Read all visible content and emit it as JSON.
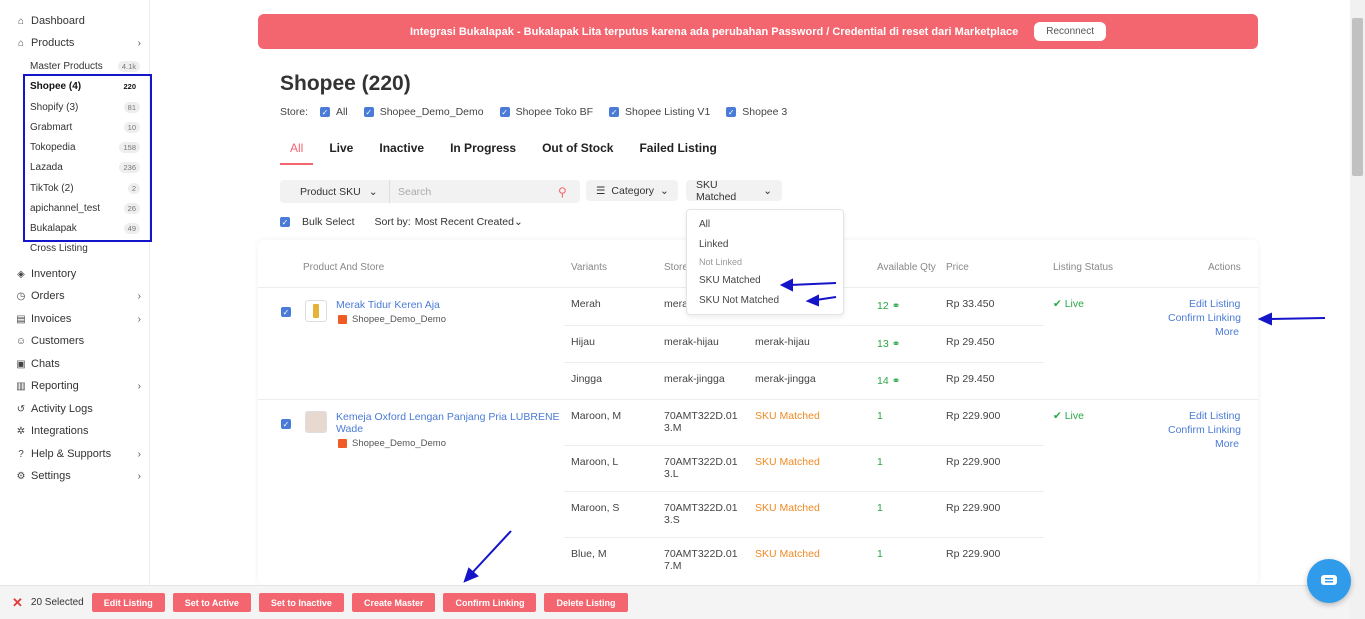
{
  "sidebar": {
    "dashboard": "Dashboard",
    "products": "Products",
    "sub": [
      {
        "label": "Master Products",
        "count": "4.1k"
      },
      {
        "label": "Shopee (4)",
        "count": "220"
      },
      {
        "label": "Shopify (3)",
        "count": "81"
      },
      {
        "label": "Grabmart",
        "count": "10"
      },
      {
        "label": "Tokopedia",
        "count": "158"
      },
      {
        "label": "Lazada",
        "count": "236"
      },
      {
        "label": "TikTok (2)",
        "count": "2"
      },
      {
        "label": "apichannel_test",
        "count": "26"
      },
      {
        "label": "Bukalapak",
        "count": "49"
      },
      {
        "label": "Cross Listing",
        "count": ""
      }
    ],
    "inventory": "Inventory",
    "orders": "Orders",
    "invoices": "Invoices",
    "customers": "Customers",
    "chats": "Chats",
    "reporting": "Reporting",
    "activity": "Activity Logs",
    "integrations": "Integrations",
    "help": "Help & Supports",
    "settings": "Settings"
  },
  "banner": {
    "text": "Integrasi Bukalapak - Bukalapak Lita terputus karena ada perubahan Password / Credential di reset dari Marketplace",
    "button": "Reconnect"
  },
  "page": {
    "title": "Shopee (220)",
    "store_label": "Store:",
    "stores": [
      "All",
      "Shopee_Demo_Demo",
      "Shopee Toko BF",
      "Shopee Listing V1",
      "Shopee 3"
    ],
    "tabs": [
      "All",
      "Live",
      "Inactive",
      "In Progress",
      "Out of Stock",
      "Failed Listing"
    ]
  },
  "filters": {
    "select": "Product SKU",
    "search_placeholder": "Search",
    "category": "Category",
    "sku": "SKU Matched",
    "bulk": "Bulk Select",
    "sort_label": "Sort by:",
    "sort_value": "Most Recent Created"
  },
  "dropdown": [
    "All",
    "Linked",
    "Not Linked",
    "SKU Matched",
    "SKU Not Matched"
  ],
  "table": {
    "headers": [
      "Product And Store",
      "Variants",
      "Store",
      "Available Qty",
      "Price",
      "Listing Status",
      "Actions"
    ],
    "products": [
      {
        "name": "Merak Tidur Keren Aja",
        "store": "Shopee_Demo_Demo",
        "status": "Live",
        "actions": [
          "Edit Listing",
          "Confirm Linking",
          "More"
        ],
        "variants": [
          {
            "variant": "Merah",
            "store_sku": "merah",
            "master": "",
            "qty": "12",
            "price": "Rp 33.450"
          },
          {
            "variant": "Hijau",
            "store_sku": "merak-hijau",
            "master": "merak-hijau",
            "qty": "13",
            "price": "Rp 29.450"
          },
          {
            "variant": "Jingga",
            "store_sku": "merak-jingga",
            "master": "merak-jingga",
            "qty": "14",
            "price": "Rp 29.450"
          }
        ]
      },
      {
        "name": "Kemeja Oxford Lengan Panjang Pria LUBRENE Wade",
        "store": "Shopee_Demo_Demo",
        "status": "Live",
        "actions": [
          "Edit Listing",
          "Confirm Linking",
          "More"
        ],
        "variants": [
          {
            "variant": "Maroon, M",
            "store_sku": "70AMT322D.013.M",
            "master": "SKU Matched",
            "qty": "1",
            "price": "Rp 229.900"
          },
          {
            "variant": "Maroon, L",
            "store_sku": "70AMT322D.013.L",
            "master": "SKU Matched",
            "qty": "1",
            "price": "Rp 229.900"
          },
          {
            "variant": "Maroon, S",
            "store_sku": "70AMT322D.013.S",
            "master": "SKU Matched",
            "qty": "1",
            "price": "Rp 229.900"
          },
          {
            "variant": "Blue, M",
            "store_sku": "70AMT322D.017.M",
            "master": "SKU Matched",
            "qty": "1",
            "price": "Rp 229.900"
          }
        ]
      }
    ]
  },
  "bottom": {
    "selected": "20 Selected",
    "buttons": [
      "Edit Listing",
      "Set to Active",
      "Set to Inactive",
      "Create Master",
      "Confirm Linking",
      "Delete Listing"
    ]
  },
  "colors": {
    "accent": "#f3666f",
    "link": "#4a7bd6",
    "annotation": "#1414c8"
  }
}
